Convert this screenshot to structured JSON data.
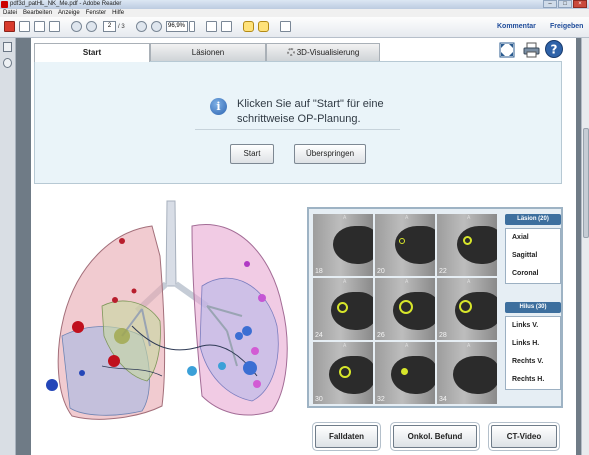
{
  "window": {
    "title": "pdf3d_patHL_NK_Me.pdf - Adobe Reader"
  },
  "menu": [
    "Datei",
    "Bearbeiten",
    "Anzeige",
    "Fenster",
    "Hilfe"
  ],
  "toolbar": {
    "page_current": "2",
    "page_total": "/ 3",
    "zoom": "96,9%",
    "comment_link": "Kommentar",
    "share_link": "Freigeben"
  },
  "tabs": [
    {
      "label": "Start",
      "active": true
    },
    {
      "label": "Läsionen",
      "active": false
    },
    {
      "label": "3D-Visualisierung",
      "active": false
    }
  ],
  "info": {
    "line1": "Klicken Sie auf \"Start\" für eine",
    "line2": "schrittweise OP-Planung.",
    "start_button": "Start",
    "skip_button": "Überspringen"
  },
  "ct": {
    "slices": [
      "18",
      "20",
      "22",
      "24",
      "26",
      "28",
      "30",
      "32",
      "34"
    ],
    "lesion_group": "Läsion (20)",
    "views": [
      "Axial",
      "Sagittal",
      "Coronal"
    ],
    "hilus_group": "Hilus (30)",
    "hilus_views": [
      "Links V.",
      "Links H.",
      "Rechts V.",
      "Rechts H."
    ]
  },
  "bottom_buttons": {
    "falldaten": "Falldaten",
    "onkol": "Onkol. Befund",
    "ctvideo": "CT-Video"
  },
  "colors": {
    "accent": "#3d6f9e",
    "lesion_outline": "#d7e62b",
    "link": "#1f4c9a"
  }
}
